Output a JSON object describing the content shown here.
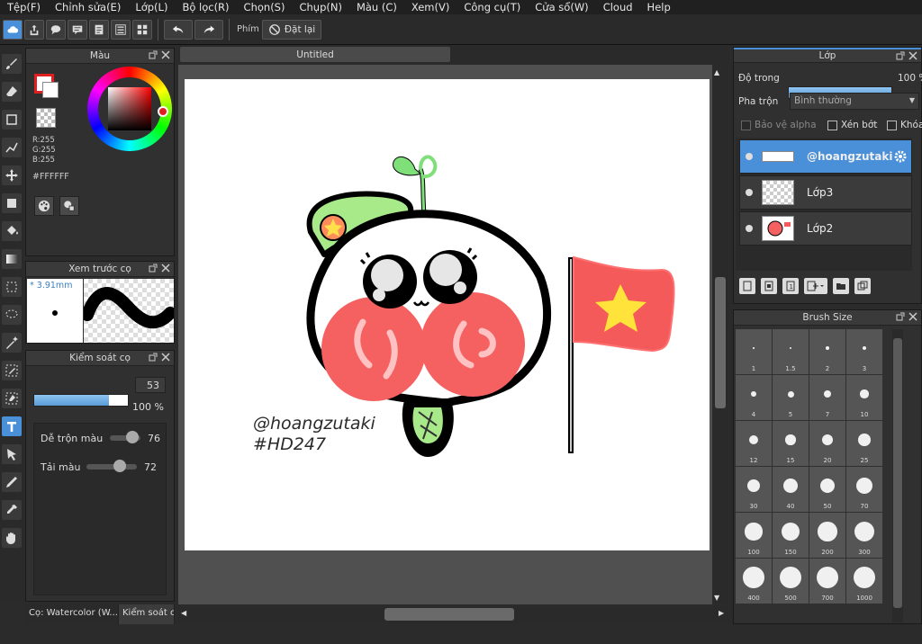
{
  "menu": [
    "Tệp(F)",
    "Chỉnh sửa(E)",
    "Lớp(L)",
    "Bộ lọc(R)",
    "Chọn(S)",
    "Chụp(N)",
    "Màu (C)",
    "Xem(V)",
    "Công cụ(T)",
    "Cửa sổ(W)",
    "Cloud",
    "Help"
  ],
  "toolbar": {
    "shortcut_label": "Phím",
    "reset_label": "Đặt lại"
  },
  "color_panel": {
    "title": "Màu",
    "r": "R:255",
    "g": "G:255",
    "b": "B:255",
    "hex": "#FFFFFF"
  },
  "brush_preview": {
    "title": "Xem trước cọ",
    "size": "3.91mm"
  },
  "brush_control": {
    "title": "Kiểm soát cọ",
    "size_value": "53",
    "size_fill": 0.8,
    "opacity_value": "100 %",
    "opacity_fill": 1.0,
    "blend_label": "Dễ trộn màu",
    "blend_value": "76",
    "reload_label": "Tải màu",
    "reload_value": "72"
  },
  "bottom_tabs": [
    "Cọ: Watercolor (W...",
    "Kiểm soát c"
  ],
  "canvas": {
    "tab_title": "Untitled",
    "signature_line1": "@hoangzutaki",
    "signature_line2": "#HD247"
  },
  "layer_panel": {
    "title": "Lớp",
    "opacity_label": "Độ trong",
    "opacity_value": "100 %",
    "blend_label": "Pha trộn",
    "blend_value": "Bình thường",
    "protect_alpha": "Bảo vệ alpha",
    "clipping": "Xén bớt",
    "lock": "Khóa",
    "layers": [
      {
        "name": "@hoangzutaki",
        "selected": true
      },
      {
        "name": "Lớp3",
        "selected": false
      },
      {
        "name": "Lớp2",
        "selected": false
      }
    ]
  },
  "brush_size": {
    "title": "Brush Size",
    "sizes": [
      "1",
      "1.5",
      "2",
      "3",
      "4",
      "5",
      "7",
      "10",
      "12",
      "15",
      "20",
      "25",
      "30",
      "40",
      "50",
      "70",
      "100",
      "150",
      "200",
      "300",
      "400",
      "500",
      "700",
      "1000"
    ]
  },
  "colors": {
    "accent": "#4a90d9",
    "panel": "#303030",
    "canvas": "#ffffff"
  }
}
